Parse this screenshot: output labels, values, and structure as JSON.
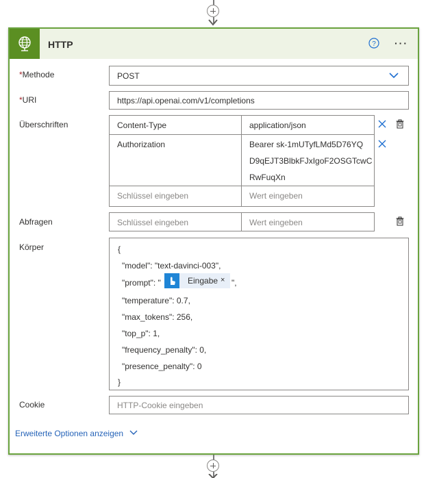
{
  "action": {
    "title": "HTTP",
    "help_symbol": "?",
    "more_symbol": "···",
    "icons": {
      "brand": "globe-icon",
      "help": "help-circle-icon",
      "more": "more-icon"
    }
  },
  "fields": {
    "method": {
      "label": "Methode",
      "required_mark": "*",
      "value": "POST"
    },
    "uri": {
      "label": "URI",
      "required_mark": "*",
      "value": "https://api.openai.com/v1/completions"
    },
    "headers": {
      "label": "Überschriften",
      "rows": [
        {
          "key": "Content-Type",
          "value": "application/json"
        },
        {
          "key": "Authorization",
          "value_lines": [
            "Bearer sk-1mUTyfLMd5D76YQ",
            "D9qEJT3BlbkFJxIgoF2OSGTcwC",
            "RwFuqXn"
          ]
        }
      ],
      "key_placeholder": "Schlüssel eingeben",
      "value_placeholder": "Wert eingeben"
    },
    "queries": {
      "label": "Abfragen",
      "key_placeholder": "Schlüssel eingeben",
      "value_placeholder": "Wert eingeben"
    },
    "body": {
      "label": "Körper",
      "lines": {
        "open": "{",
        "model": "\"model\": \"text-davinci-003\",",
        "prompt_prefix": "\"prompt\": \"",
        "prompt_suffix": "\",",
        "temperature": "\"temperature\": 0.7,",
        "max_tokens": "\"max_tokens\": 256,",
        "top_p": "\"top_p\": 1,",
        "frequency_penalty": "\"frequency_penalty\": 0,",
        "presence_penalty": "\"presence_penalty\": 0",
        "close": "}"
      },
      "token": {
        "label": "Eingabe",
        "close_symbol": "×",
        "icon": "touch-icon"
      }
    },
    "cookie": {
      "label": "Cookie",
      "placeholder": "HTTP-Cookie eingeben"
    }
  },
  "advanced_options": {
    "label": "Erweiterte Optionen anzeigen"
  },
  "colors": {
    "accent_green": "#5b8f22",
    "border_green": "#6aa33e",
    "link_blue": "#2563b8",
    "token_blue": "#1f85d6"
  }
}
